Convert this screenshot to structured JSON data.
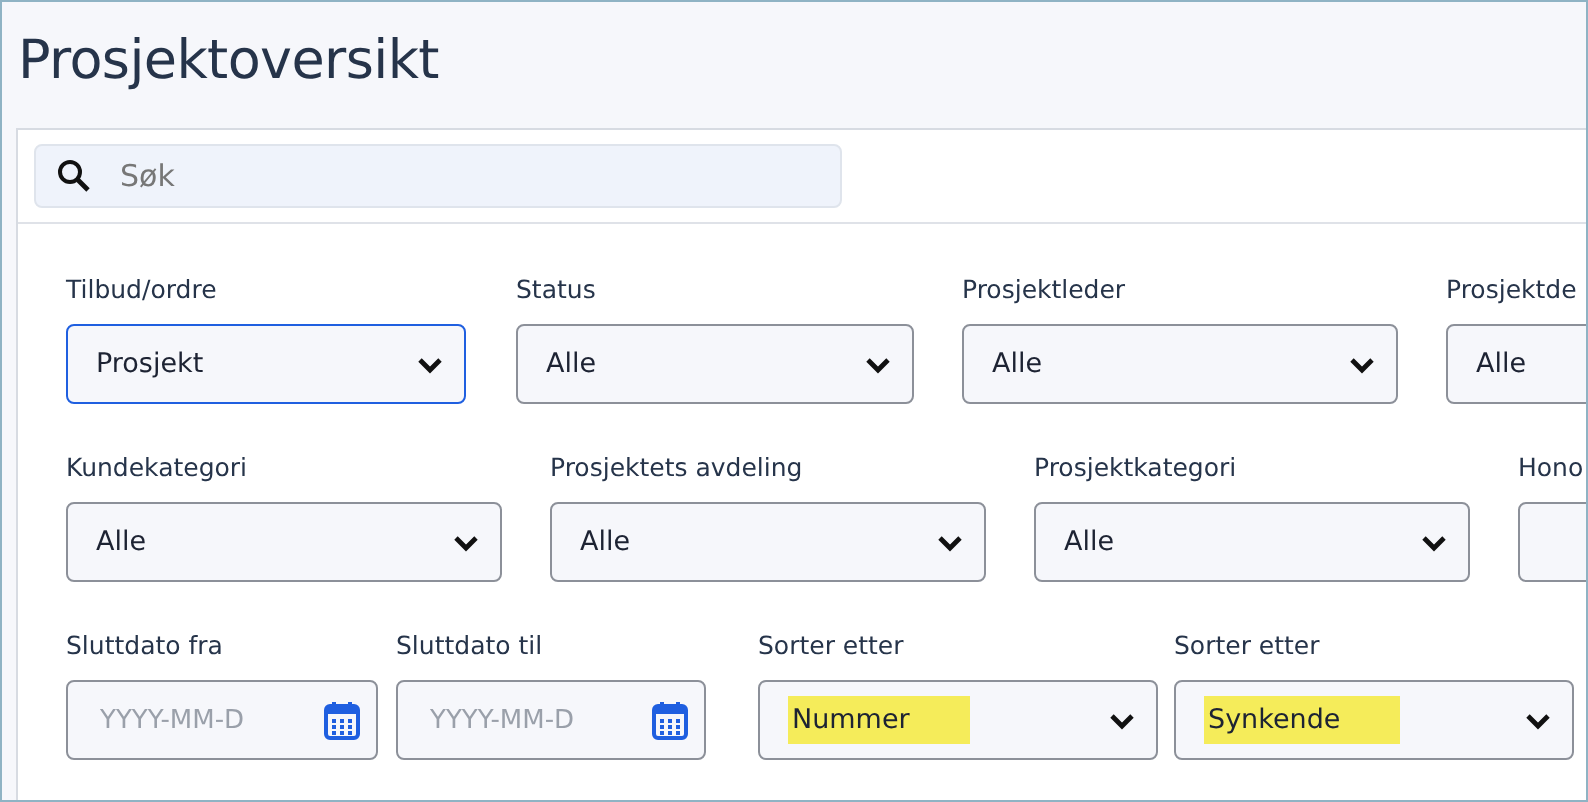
{
  "title": "Prosjektoversikt",
  "search": {
    "placeholder": "Søk"
  },
  "filter_rows": [
    {
      "fields": [
        {
          "kind": "select",
          "label": "Tilbud/ordre",
          "value": "Prosjekt",
          "focused": true
        },
        {
          "kind": "select",
          "label": "Status",
          "value": "Alle",
          "focused": false
        },
        {
          "kind": "select",
          "label": "Prosjektleder",
          "value": "Alle",
          "focused": false
        },
        {
          "kind": "select",
          "label": "Prosjektde",
          "value": "Alle",
          "focused": false
        }
      ]
    },
    {
      "fields": [
        {
          "kind": "select",
          "label": "Kundekategori",
          "value": "Alle",
          "focused": false
        },
        {
          "kind": "select",
          "label": "Prosjektets avdeling",
          "value": "Alle",
          "focused": false
        },
        {
          "kind": "select",
          "label": "Prosjektkategori",
          "value": "Alle",
          "focused": false
        },
        {
          "kind": "select",
          "label": "Hono",
          "focused": false
        }
      ]
    },
    {
      "fields": [
        {
          "kind": "date",
          "label": "Sluttdato fra",
          "placeholder": "YYYY-MM-D"
        },
        {
          "kind": "date",
          "label": "Sluttdato til",
          "placeholder": "YYYY-MM-D"
        },
        {
          "kind": "select",
          "label": "Sorter etter",
          "value": "Nummer",
          "focused": false,
          "highlighted": true
        },
        {
          "kind": "select",
          "label": "Sorter etter",
          "value": "Synkende",
          "focused": false,
          "highlighted": true
        }
      ]
    }
  ]
}
